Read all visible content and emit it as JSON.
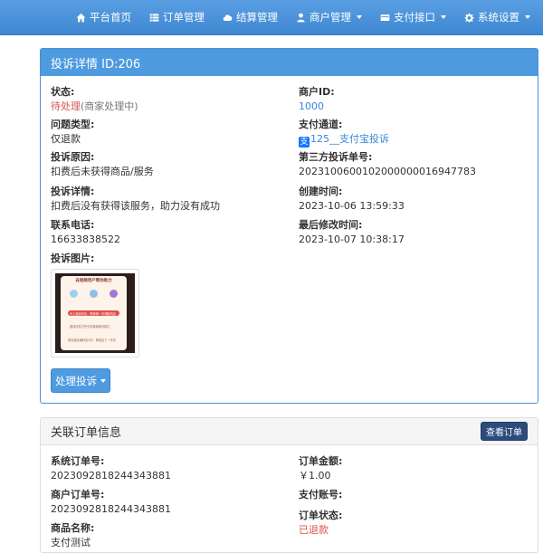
{
  "nav": {
    "items": [
      {
        "label": "平台首页",
        "icon": "home-icon"
      },
      {
        "label": "订单管理",
        "icon": "list-icon"
      },
      {
        "label": "结算管理",
        "icon": "cloud-icon"
      },
      {
        "label": "商户管理",
        "icon": "user-icon"
      },
      {
        "label": "支付接口",
        "icon": "credit-card-icon"
      },
      {
        "label": "系统设置",
        "icon": "gear-icon"
      }
    ]
  },
  "complaint": {
    "title": "投诉详情 ID:206",
    "status_label": "状态:",
    "status_value": "待处理",
    "status_note": "(商家处理中)",
    "type_label": "问题类型:",
    "type_value": "仅退款",
    "reason_label": "投诉原因:",
    "reason_value": "扣费后未获得商品/服务",
    "detail_label": "投诉详情:",
    "detail_value": "扣费后没有获得该服务，助力没有成功",
    "phone_label": "联系电话:",
    "phone_value": "16633838522",
    "image_label": "投诉图片:",
    "merchant_label": "商户ID:",
    "merchant_value": "1000",
    "channel_label": "支付通道:",
    "channel_icon_text": "支",
    "channel_value": "125__支付宝投诉",
    "third_no_label": "第三方投诉单号:",
    "third_no_value": "2023100600102000000016947783",
    "created_label": "创建时间:",
    "created_value": "2023-10-06 13:59:33",
    "modified_label": "最后修改时间:",
    "modified_value": "2023-10-07 10:38:17",
    "handle_button": "处理投诉"
  },
  "thumbnail": {
    "title": "去视频用户帮你助力",
    "bar1_text": "马上邀请好友，再获得一次领取机会",
    "line1_text": "邀请好友打开分享链接即可助力",
    "line2_text": "成功邀请满好友3次，即送出了一次次"
  },
  "order": {
    "title": "关联订单信息",
    "view_button": "查看订单",
    "sys_no_label": "系统订单号:",
    "sys_no_value": "2023092818244343881",
    "merchant_no_label": "商户订单号:",
    "merchant_no_value": "2023092818244343881",
    "product_label": "商品名称:",
    "product_value": "支付测试",
    "amount_label": "订单金额:",
    "amount_value": "￥1.00",
    "account_label": "支付账号:",
    "order_status_label": "订单状态:",
    "order_status_value": "已退款"
  },
  "colors": {
    "navbar": "#4a90d9",
    "panel_header": "#4e9be0",
    "status_red": "#d9534f",
    "link_blue": "#3a87d6",
    "view_button": "#2c4c7e"
  }
}
